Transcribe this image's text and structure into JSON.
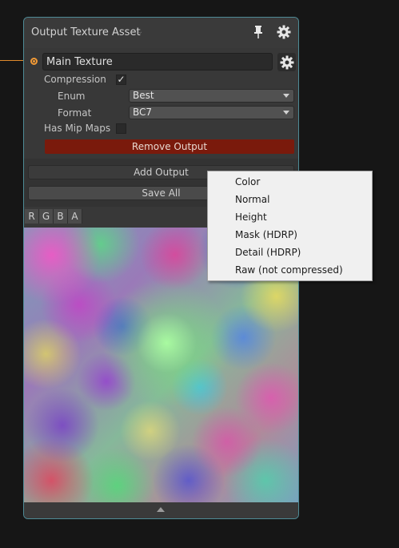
{
  "node": {
    "title": "Output Texture Asset",
    "title_icon": "chevron-down-icon",
    "pin_icon": "pin-icon",
    "settings_icon": "gear-icon",
    "accent_color": "#4e8b96",
    "port_color": "#f29a36"
  },
  "output": {
    "name": "Main Texture",
    "compression_label": "Compression",
    "compression_checked": "✓",
    "enum_label": "Enum",
    "enum_value": "Best",
    "format_label": "Format",
    "format_value": "BC7",
    "mipmaps_label": "Has Mip Maps",
    "remove_label": "Remove Output",
    "remove_color": "#7a1a0c"
  },
  "actions": {
    "add_output": "Add Output",
    "save_all": "Save All"
  },
  "channels": [
    "R",
    "G",
    "B",
    "A"
  ],
  "context_menu": {
    "items": [
      "Color",
      "Normal",
      "Height",
      "Mask (HDRP)",
      "Detail (HDRP)",
      "Raw (not compressed)"
    ]
  }
}
